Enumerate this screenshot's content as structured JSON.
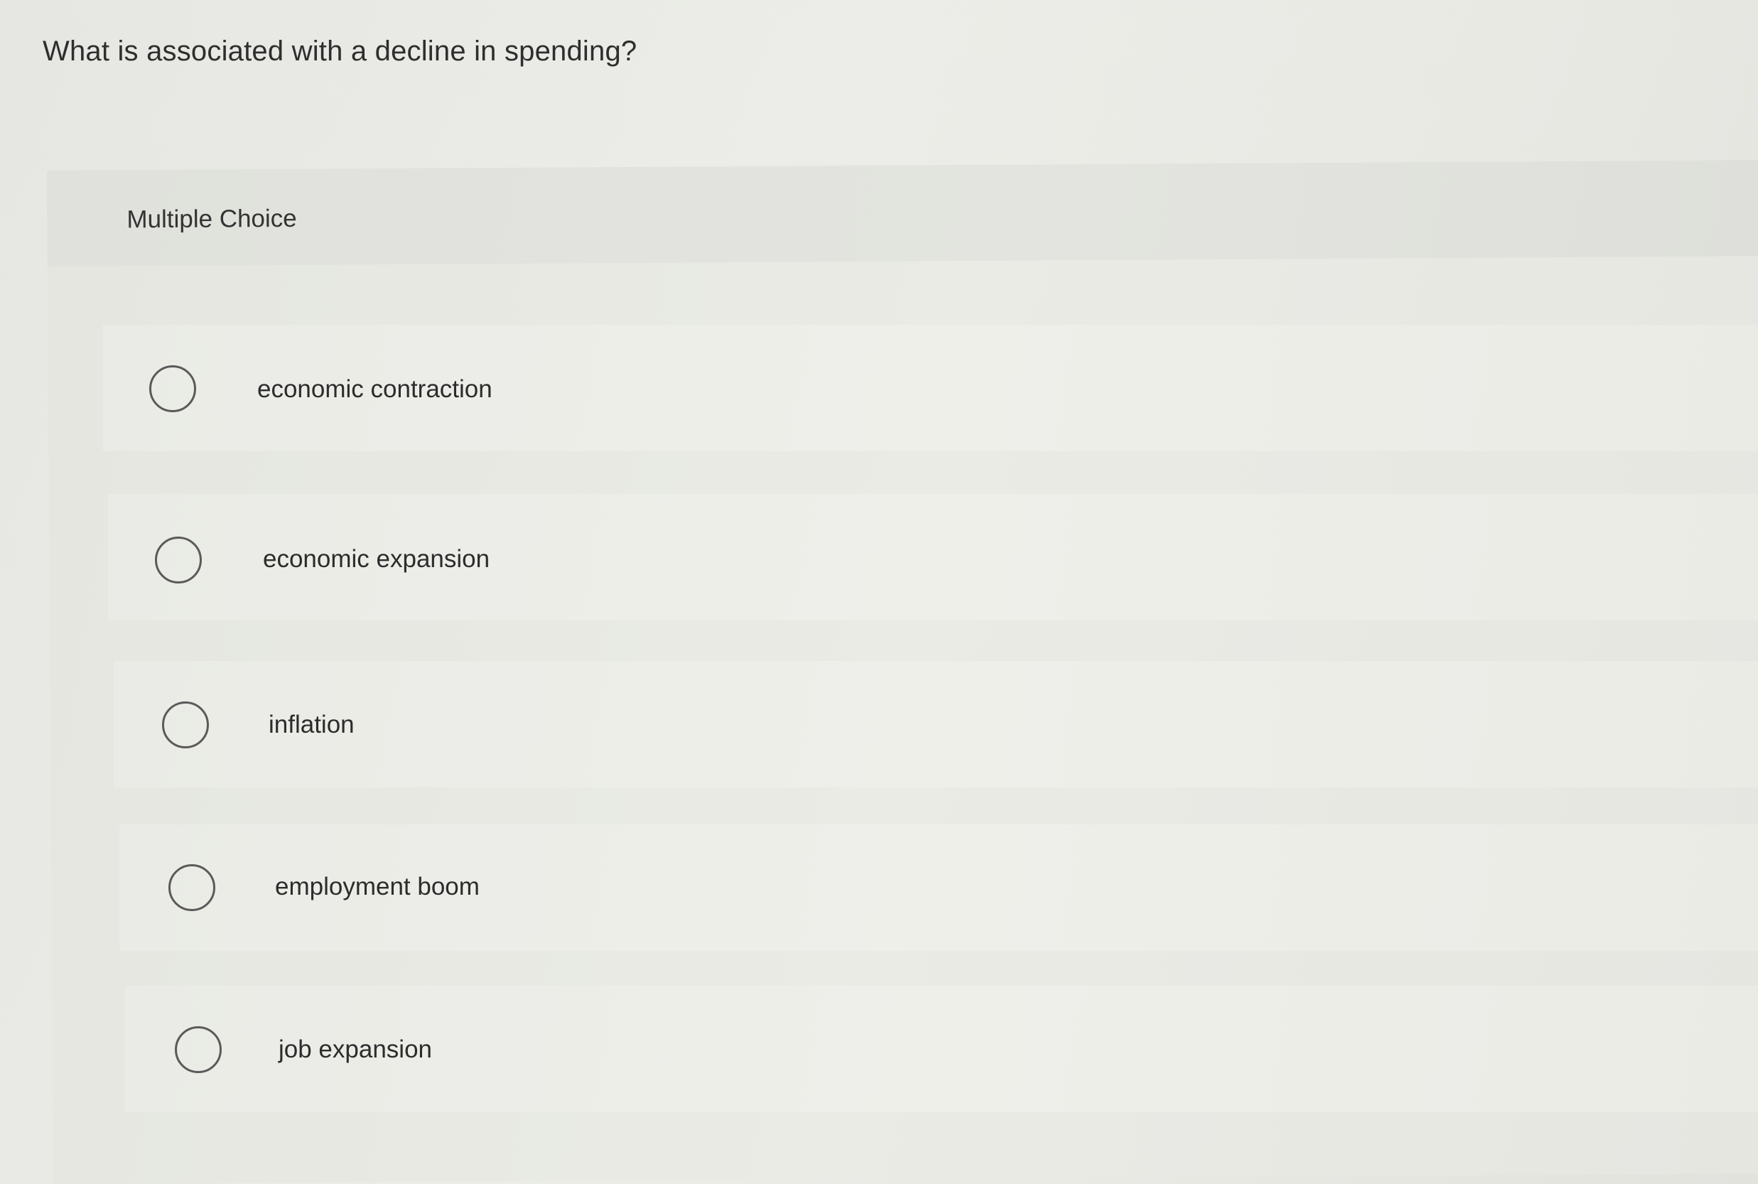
{
  "question": {
    "text": "What is associated with a decline in spending?"
  },
  "multiple_choice": {
    "label": "Multiple Choice",
    "options": [
      {
        "text": "economic contraction",
        "selected": false
      },
      {
        "text": "economic expansion",
        "selected": false
      },
      {
        "text": "inflation",
        "selected": false
      },
      {
        "text": "employment boom",
        "selected": false
      },
      {
        "text": "job expansion",
        "selected": false
      }
    ]
  }
}
